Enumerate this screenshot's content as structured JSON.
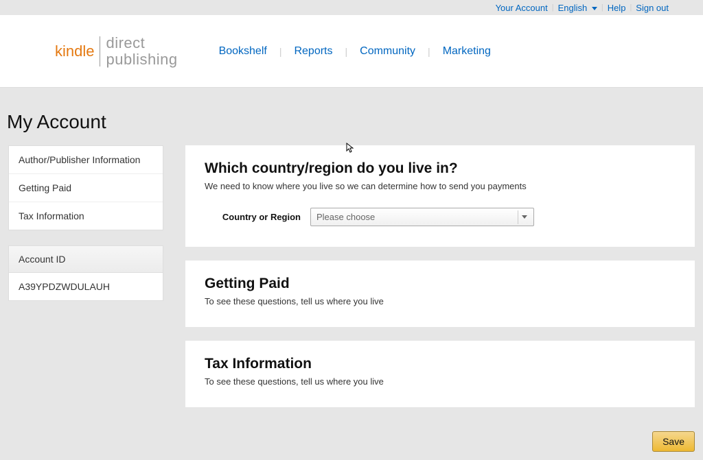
{
  "utility": {
    "your_account": "Your Account",
    "language": "English",
    "help": "Help",
    "sign_out": "Sign out"
  },
  "logo": {
    "kindle": "kindle",
    "direct": "direct",
    "publishing": "publishing"
  },
  "nav": {
    "bookshelf": "Bookshelf",
    "reports": "Reports",
    "community": "Community",
    "marketing": "Marketing"
  },
  "page_title": "My Account",
  "sidebar": {
    "items": [
      {
        "label": "Author/Publisher Information"
      },
      {
        "label": "Getting Paid"
      },
      {
        "label": "Tax Information"
      }
    ],
    "account_id_label": "Account ID",
    "account_id_value": "A39YPDZWDULAUH"
  },
  "sections": {
    "country": {
      "title": "Which country/region do you live in?",
      "subtitle": "We need to know where you live so we can determine how to send you payments",
      "field_label": "Country or Region",
      "placeholder": "Please choose"
    },
    "getting_paid": {
      "title": "Getting Paid",
      "subtitle": "To see these questions, tell us where you live"
    },
    "tax": {
      "title": "Tax Information",
      "subtitle": "To see these questions, tell us where you live"
    }
  },
  "save_label": "Save"
}
